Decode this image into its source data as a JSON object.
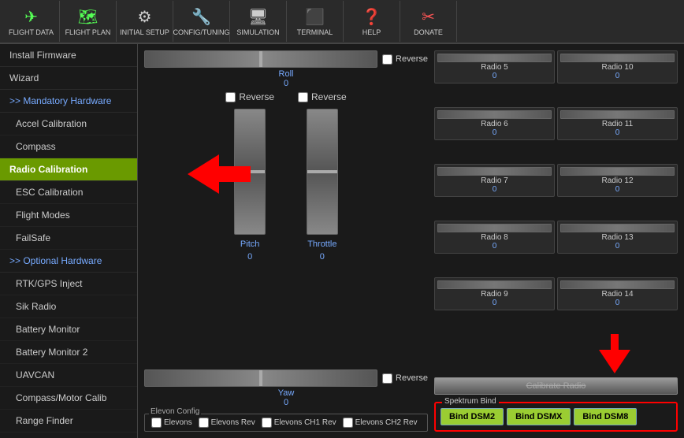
{
  "toolbar": {
    "items": [
      {
        "label": "FLIGHT DATA",
        "icon": "✈",
        "iconClass": "green"
      },
      {
        "label": "FLIGHT PLAN",
        "icon": "🗺",
        "iconClass": "green"
      },
      {
        "label": "INITIAL SETUP",
        "icon": "⚙",
        "iconClass": ""
      },
      {
        "label": "CONFIG/TUNING",
        "icon": "🔧",
        "iconClass": ""
      },
      {
        "label": "SIMULATION",
        "icon": "🖥",
        "iconClass": ""
      },
      {
        "label": "TERMINAL",
        "icon": "⬛",
        "iconClass": ""
      },
      {
        "label": "HELP",
        "icon": "❓",
        "iconClass": "green"
      },
      {
        "label": "DONATE",
        "icon": "✂",
        "iconClass": "red"
      }
    ]
  },
  "sidebar": {
    "items": [
      {
        "label": "Install Firmware",
        "type": "item"
      },
      {
        "label": "Wizard",
        "type": "item"
      },
      {
        "label": ">> Mandatory Hardware",
        "type": "section"
      },
      {
        "label": "Accel Calibration",
        "type": "sub"
      },
      {
        "label": "Compass",
        "type": "sub"
      },
      {
        "label": "Radio Calibration",
        "type": "active"
      },
      {
        "label": "ESC Calibration",
        "type": "sub"
      },
      {
        "label": "Flight Modes",
        "type": "sub"
      },
      {
        "label": "FailSafe",
        "type": "sub"
      },
      {
        "label": ">> Optional Hardware",
        "type": "section"
      },
      {
        "label": "RTK/GPS Inject",
        "type": "sub"
      },
      {
        "label": "Sik Radio",
        "type": "sub"
      },
      {
        "label": "Battery Monitor",
        "type": "sub"
      },
      {
        "label": "Battery Monitor 2",
        "type": "sub"
      },
      {
        "label": "UAVCAN",
        "type": "sub"
      },
      {
        "label": "Compass/Motor Calib",
        "type": "sub"
      },
      {
        "label": "Range Finder",
        "type": "sub"
      }
    ]
  },
  "radio": {
    "roll": {
      "label": "Roll",
      "value": "0"
    },
    "pitch": {
      "label": "Pitch",
      "value": "0"
    },
    "throttle": {
      "label": "Throttle",
      "value": "0"
    },
    "yaw": {
      "label": "Yaw",
      "value": "0"
    },
    "channels": [
      {
        "name": "Radio 5",
        "value": "0"
      },
      {
        "name": "Radio 10",
        "value": "0"
      },
      {
        "name": "Radio 6",
        "value": "0"
      },
      {
        "name": "Radio 11",
        "value": "0"
      },
      {
        "name": "Radio 7",
        "value": "0"
      },
      {
        "name": "Radio 12",
        "value": "0"
      },
      {
        "name": "Radio 8",
        "value": "0"
      },
      {
        "name": "Radio 13",
        "value": "0"
      },
      {
        "name": "Radio 9",
        "value": "0"
      },
      {
        "name": "Radio 14",
        "value": "0"
      }
    ],
    "calibrate_btn": "Calibrate Radio",
    "reverse_label": "Reverse"
  },
  "spektrum": {
    "label": "Spektrum Bind",
    "buttons": [
      "Bind DSM2",
      "Bind DSMX",
      "Bind DSM8"
    ]
  },
  "elevon": {
    "label": "Elevon Config",
    "checks": [
      "Elevons",
      "Elevons Rev",
      "Elevons CH1 Rev",
      "Elevons CH2 Rev"
    ]
  }
}
